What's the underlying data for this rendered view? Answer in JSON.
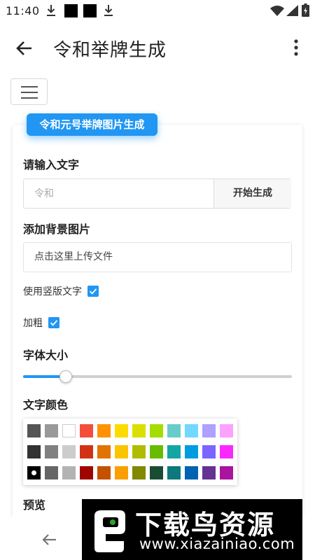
{
  "status_bar": {
    "time": "11:40"
  },
  "toolbar": {
    "title": "令和举牌生成"
  },
  "card": {
    "tag": "令和元号举牌图片生成",
    "text_label": "请输入文字",
    "text_placeholder": "令和",
    "generate_label": "开始生成",
    "background_label": "添加背景图片",
    "upload_label": "点击这里上传文件",
    "vertical_label": "使用竖版文字",
    "vertical_checked": true,
    "bold_label": "加粗",
    "bold_checked": true,
    "font_size_label": "字体大小",
    "font_size_fraction": 0.16,
    "text_color_label": "文字颜色",
    "preview_label": "预览"
  },
  "palette": {
    "selected": "#000000",
    "rows": [
      [
        "#555555",
        "#999999",
        "#ffffff",
        "#f44e3b",
        "#fe9200",
        "#fcdc00",
        "#dbdf00",
        "#a4dd00",
        "#68ccca",
        "#73d8ff",
        "#aea1ff",
        "#fda1ff"
      ],
      [
        "#333333",
        "#808080",
        "#cccccc",
        "#d33115",
        "#e27300",
        "#fcc400",
        "#b0bc00",
        "#68bc00",
        "#16a5a5",
        "#009ce0",
        "#7b64ff",
        "#fa28ff"
      ],
      [
        "#000000",
        "#666666",
        "#b3b3b3",
        "#9f0500",
        "#c45100",
        "#fb9e00",
        "#808900",
        "#194d33",
        "#0c797d",
        "#0062b1",
        "#653294",
        "#ab149e"
      ]
    ]
  },
  "watermark": {
    "big": "下载鸟资源",
    "small": "www.xiazainiao.com"
  },
  "colors": {
    "accent": "#2196f3"
  }
}
